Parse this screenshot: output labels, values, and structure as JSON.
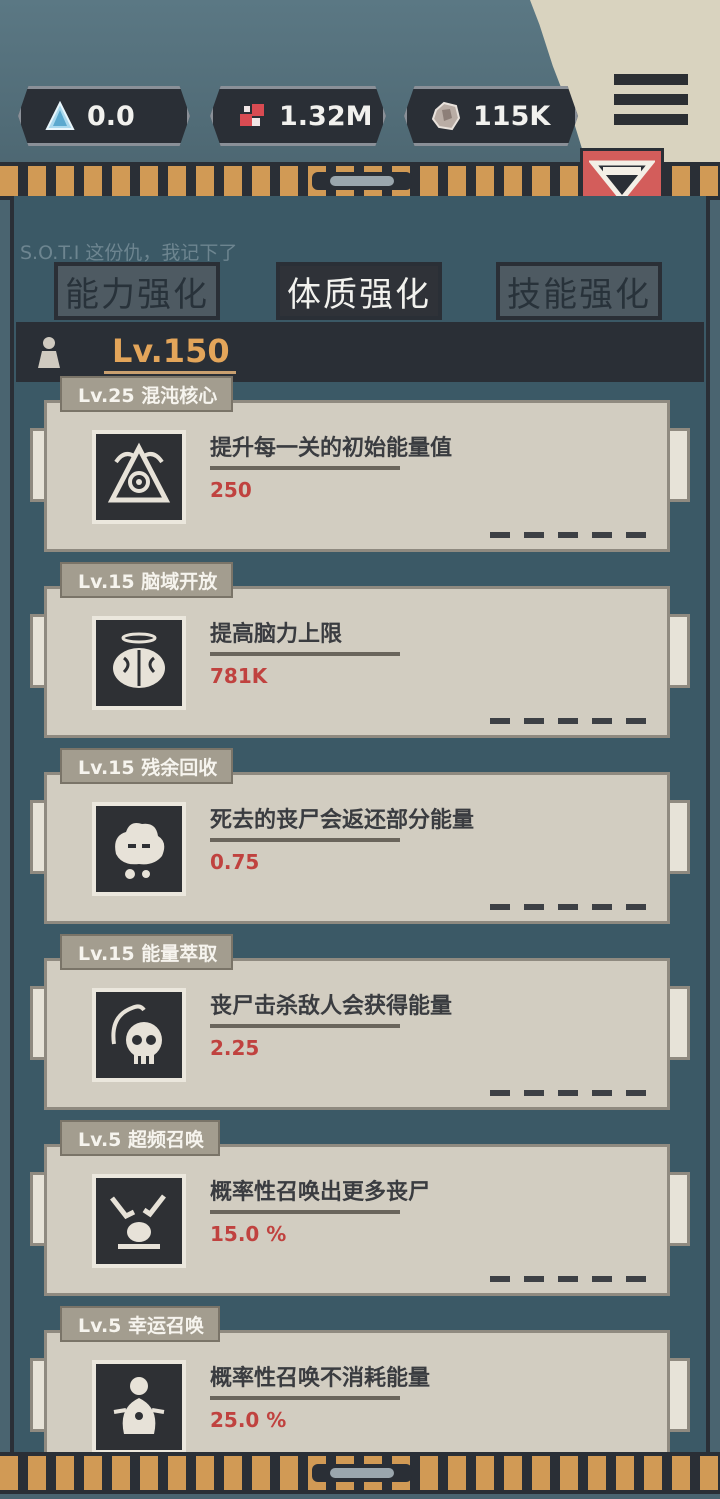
{
  "resources": [
    {
      "icon": "crystal-icon",
      "value": "0.0"
    },
    {
      "icon": "gem-icon",
      "value": "1.32M"
    },
    {
      "icon": "rock-icon",
      "value": "115K"
    }
  ],
  "background_text": "S.O.T.I  这份仇，我记下了",
  "tabs": [
    {
      "label": "能力强化",
      "active": false
    },
    {
      "label": "体质强化",
      "active": true
    },
    {
      "label": "技能强化",
      "active": false
    }
  ],
  "level": "Lv.150",
  "skills": [
    {
      "tag": "Lv.25 混沌核心",
      "desc": "提升每一关的初始能量值",
      "value": "250",
      "icon": "chaos-core-icon"
    },
    {
      "tag": "Lv.15 脑域开放",
      "desc": "提高脑力上限",
      "value": "781K",
      "icon": "brain-icon"
    },
    {
      "tag": "Lv.15 残余回收",
      "desc": "死去的丧尸会返还部分能量",
      "value": "0.75",
      "icon": "residue-icon"
    },
    {
      "tag": "Lv.15 能量萃取",
      "desc": "丧尸击杀敌人会获得能量",
      "value": "2.25",
      "icon": "skull-icon"
    },
    {
      "tag": "Lv.5 超频召唤",
      "desc": "概率性召唤出更多丧尸",
      "value": "15.0 %",
      "icon": "summon-hands-icon"
    },
    {
      "tag": "Lv.5 幸运召唤",
      "desc": "概率性召唤不消耗能量",
      "value": "25.0 %",
      "icon": "lucky-idol-icon"
    }
  ],
  "colors": {
    "accent": "#e3a55a",
    "value_red": "#c0423f",
    "collapse_btn": "#d35d5b"
  }
}
